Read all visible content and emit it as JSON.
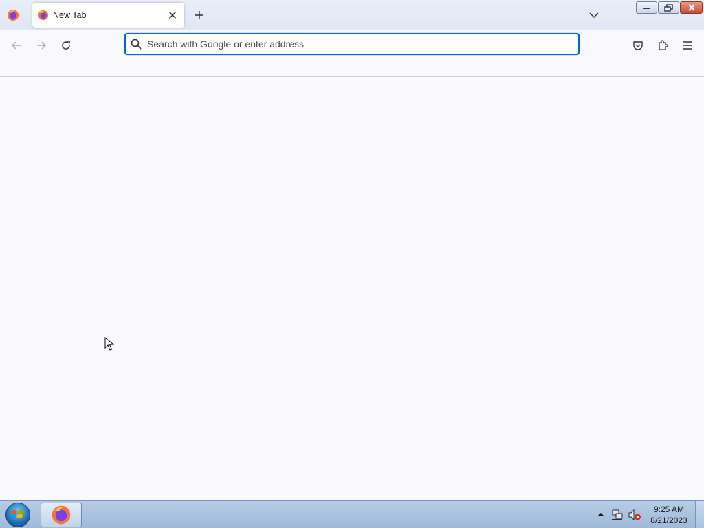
{
  "browser": {
    "tab": {
      "title": "New Tab"
    },
    "urlbar": {
      "placeholder": "Search with Google or enter address",
      "value": ""
    }
  },
  "taskbar": {
    "clock": {
      "time": "9:25 AM",
      "date": "8/21/2023"
    }
  },
  "icons": {
    "firefox": "firefox-icon",
    "back": "arrow-left-icon",
    "forward": "arrow-right-icon",
    "reload": "reload-icon",
    "search": "search-icon",
    "pocket": "pocket-icon",
    "extensions": "puzzle-icon",
    "menu": "hamburger-icon",
    "close": "close-icon",
    "new_tab": "plus-icon",
    "tab_list": "chevron-down-icon"
  },
  "colors": {
    "accent": "#0061e0",
    "content_bg": "#f9f9fb",
    "taskbar": "#a9c2e0"
  }
}
